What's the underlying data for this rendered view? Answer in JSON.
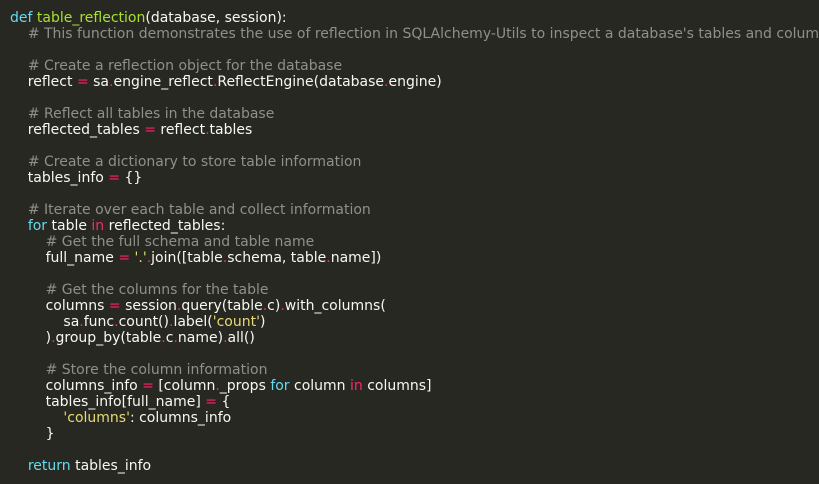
{
  "editor": {
    "language": "python",
    "theme": "monokai",
    "colors": {
      "background": "#272822",
      "text": "#f8f8f2",
      "keyword": "#66d9ef",
      "function_name": "#a6e22e",
      "comment": "#8f908a",
      "operator": "#f92672",
      "string": "#e6db74"
    },
    "lines": [
      [
        {
          "t": "kw",
          "v": "def"
        },
        {
          "t": "pl",
          "v": " "
        },
        {
          "t": "fn",
          "v": "table_reflection"
        },
        {
          "t": "pl",
          "v": "(database, session):"
        }
      ],
      [
        {
          "t": "pl",
          "v": "    "
        },
        {
          "t": "cm",
          "v": "# This function demonstrates the use of reflection in SQLAlchemy-Utils to inspect a database's tables and columns."
        }
      ],
      [],
      [
        {
          "t": "pl",
          "v": "    "
        },
        {
          "t": "cm",
          "v": "# Create a reflection object for the database"
        }
      ],
      [
        {
          "t": "pl",
          "v": "    reflect "
        },
        {
          "t": "op",
          "v": "="
        },
        {
          "t": "pl",
          "v": " sa"
        },
        {
          "t": "op",
          "v": "."
        },
        {
          "t": "pl",
          "v": "engine_reflect"
        },
        {
          "t": "op",
          "v": "."
        },
        {
          "t": "pl",
          "v": "ReflectEngine(database"
        },
        {
          "t": "op",
          "v": "."
        },
        {
          "t": "pl",
          "v": "engine)"
        }
      ],
      [],
      [
        {
          "t": "pl",
          "v": "    "
        },
        {
          "t": "cm",
          "v": "# Reflect all tables in the database"
        }
      ],
      [
        {
          "t": "pl",
          "v": "    reflected_tables "
        },
        {
          "t": "op",
          "v": "="
        },
        {
          "t": "pl",
          "v": " reflect"
        },
        {
          "t": "op",
          "v": "."
        },
        {
          "t": "pl",
          "v": "tables"
        }
      ],
      [],
      [
        {
          "t": "pl",
          "v": "    "
        },
        {
          "t": "cm",
          "v": "# Create a dictionary to store table information"
        }
      ],
      [
        {
          "t": "pl",
          "v": "    tables_info "
        },
        {
          "t": "op",
          "v": "="
        },
        {
          "t": "pl",
          "v": " {}"
        }
      ],
      [],
      [
        {
          "t": "pl",
          "v": "    "
        },
        {
          "t": "cm",
          "v": "# Iterate over each table and collect information"
        }
      ],
      [
        {
          "t": "pl",
          "v": "    "
        },
        {
          "t": "kw",
          "v": "for"
        },
        {
          "t": "pl",
          "v": " table "
        },
        {
          "t": "op",
          "v": "in"
        },
        {
          "t": "pl",
          "v": " reflected_tables:"
        }
      ],
      [
        {
          "t": "pl",
          "v": "        "
        },
        {
          "t": "cm",
          "v": "# Get the full schema and table name"
        }
      ],
      [
        {
          "t": "pl",
          "v": "        full_name "
        },
        {
          "t": "op",
          "v": "="
        },
        {
          "t": "pl",
          "v": " "
        },
        {
          "t": "st",
          "v": "'.'"
        },
        {
          "t": "op",
          "v": "."
        },
        {
          "t": "pl",
          "v": "join([table"
        },
        {
          "t": "op",
          "v": "."
        },
        {
          "t": "pl",
          "v": "schema, table"
        },
        {
          "t": "op",
          "v": "."
        },
        {
          "t": "pl",
          "v": "name])"
        }
      ],
      [],
      [
        {
          "t": "pl",
          "v": "        "
        },
        {
          "t": "cm",
          "v": "# Get the columns for the table"
        }
      ],
      [
        {
          "t": "pl",
          "v": "        columns "
        },
        {
          "t": "op",
          "v": "="
        },
        {
          "t": "pl",
          "v": " session"
        },
        {
          "t": "op",
          "v": "."
        },
        {
          "t": "pl",
          "v": "query(table"
        },
        {
          "t": "op",
          "v": "."
        },
        {
          "t": "pl",
          "v": "c)"
        },
        {
          "t": "op",
          "v": "."
        },
        {
          "t": "pl",
          "v": "with_columns("
        }
      ],
      [
        {
          "t": "pl",
          "v": "            sa"
        },
        {
          "t": "op",
          "v": "."
        },
        {
          "t": "pl",
          "v": "func"
        },
        {
          "t": "op",
          "v": "."
        },
        {
          "t": "pl",
          "v": "count()"
        },
        {
          "t": "op",
          "v": "."
        },
        {
          "t": "pl",
          "v": "label("
        },
        {
          "t": "st",
          "v": "'count'"
        },
        {
          "t": "pl",
          "v": ")"
        }
      ],
      [
        {
          "t": "pl",
          "v": "        )"
        },
        {
          "t": "op",
          "v": "."
        },
        {
          "t": "pl",
          "v": "group_by(table"
        },
        {
          "t": "op",
          "v": "."
        },
        {
          "t": "pl",
          "v": "c"
        },
        {
          "t": "op",
          "v": "."
        },
        {
          "t": "pl",
          "v": "name)"
        },
        {
          "t": "op",
          "v": "."
        },
        {
          "t": "pl",
          "v": "all()"
        }
      ],
      [],
      [
        {
          "t": "pl",
          "v": "        "
        },
        {
          "t": "cm",
          "v": "# Store the column information"
        }
      ],
      [
        {
          "t": "pl",
          "v": "        columns_info "
        },
        {
          "t": "op",
          "v": "="
        },
        {
          "t": "pl",
          "v": " [column"
        },
        {
          "t": "op",
          "v": "."
        },
        {
          "t": "pl",
          "v": "_props "
        },
        {
          "t": "kw",
          "v": "for"
        },
        {
          "t": "pl",
          "v": " column "
        },
        {
          "t": "op",
          "v": "in"
        },
        {
          "t": "pl",
          "v": " columns]"
        }
      ],
      [
        {
          "t": "pl",
          "v": "        tables_info[full_name] "
        },
        {
          "t": "op",
          "v": "="
        },
        {
          "t": "pl",
          "v": " {"
        }
      ],
      [
        {
          "t": "pl",
          "v": "            "
        },
        {
          "t": "st",
          "v": "'columns'"
        },
        {
          "t": "pl",
          "v": ": columns_info"
        }
      ],
      [
        {
          "t": "pl",
          "v": "        }"
        }
      ],
      [],
      [
        {
          "t": "pl",
          "v": "    "
        },
        {
          "t": "kw",
          "v": "return"
        },
        {
          "t": "pl",
          "v": " tables_info"
        }
      ]
    ]
  }
}
